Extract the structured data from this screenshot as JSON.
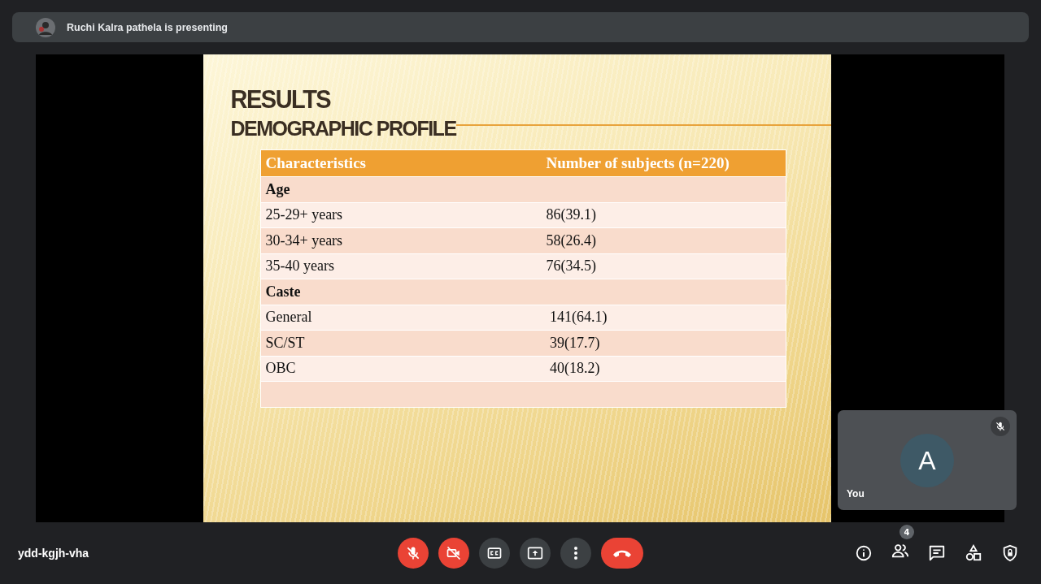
{
  "banner": {
    "text": "Ruchi Kalra pathela is presenting"
  },
  "slide": {
    "title": "RESULTS",
    "subtitle": "DEMOGRAPHIC PROFILE",
    "table": {
      "columns": [
        "Characteristics",
        "Number of subjects (n=220)"
      ],
      "rows": [
        {
          "kind": "group",
          "cells": [
            "Age"
          ]
        },
        {
          "kind": "item",
          "cells": [
            "25-29+ years",
            "86(39.1)"
          ]
        },
        {
          "kind": "item",
          "cells": [
            "30-34+ years",
            "58(26.4)"
          ]
        },
        {
          "kind": "item",
          "cells": [
            "35-40 years",
            "76(34.5)"
          ]
        },
        {
          "kind": "group",
          "cells": [
            "Caste"
          ]
        },
        {
          "kind": "item",
          "cells": [
            "General",
            " 141(64.1)"
          ]
        },
        {
          "kind": "item",
          "cells": [
            "SC/ST",
            " 39(17.7)"
          ]
        },
        {
          "kind": "item",
          "cells": [
            "OBC",
            " 40(18.2)"
          ]
        },
        {
          "kind": "blank",
          "cells": []
        }
      ]
    }
  },
  "self_tile": {
    "initial": "A",
    "name": "You",
    "mic_on": false
  },
  "meeting_code": "ydd-kgjh-vha",
  "controls": [
    {
      "kind": "mic",
      "on": false
    },
    {
      "kind": "camera",
      "on": false
    },
    {
      "kind": "captions",
      "on": false
    },
    {
      "kind": "present",
      "on": false
    },
    {
      "kind": "more",
      "on": false
    },
    {
      "kind": "leave",
      "on": false
    }
  ],
  "side_controls": [
    {
      "kind": "info"
    },
    {
      "kind": "people",
      "badge": "4"
    },
    {
      "kind": "chat"
    },
    {
      "kind": "activities"
    },
    {
      "kind": "safety"
    }
  ]
}
